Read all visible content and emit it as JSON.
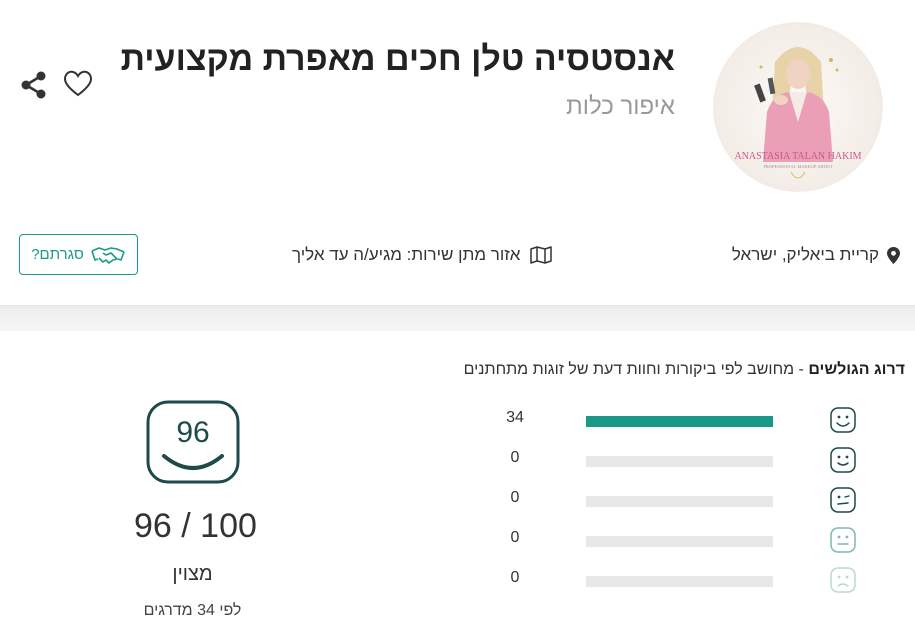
{
  "vendor": {
    "name": "אנסטסיה טלן חכים מאפרת מקצועית",
    "category": "איפור כלות",
    "logo_text": "ANASTASIA TALAN HAKIM",
    "logo_subtext": "PROFESSIONAL MAKEUP ARTIST"
  },
  "actions": {
    "share_icon": "share-icon",
    "favorite_icon": "heart-icon"
  },
  "info": {
    "location": "קריית ביאליק, ישראל",
    "service_area": "אזור מתן שירות: מגיע/ה עד אליך",
    "closed_button": "סגרתם?"
  },
  "rating": {
    "heading_bold": "דרוג הגולשים",
    "heading_rest": " - מחושב לפי ביקורות וחוות דעת של זוגות מתחתנים",
    "rows": [
      {
        "count": "34",
        "fraction": 1.0,
        "face": "very-happy-face-icon"
      },
      {
        "count": "0",
        "fraction": 0,
        "face": "happy-face-icon"
      },
      {
        "count": "0",
        "fraction": 0,
        "face": "winking-face-icon"
      },
      {
        "count": "0",
        "fraction": 0,
        "face": "neutral-face-icon"
      },
      {
        "count": "0",
        "fraction": 0,
        "face": "sad-face-icon"
      }
    ],
    "score": "96",
    "score_total": "96 / 100",
    "score_word": "מצוין",
    "score_count": "לפי 34 מדרגים",
    "accent_color": "#1a9a86",
    "icon_color": "#1e4a4a"
  }
}
